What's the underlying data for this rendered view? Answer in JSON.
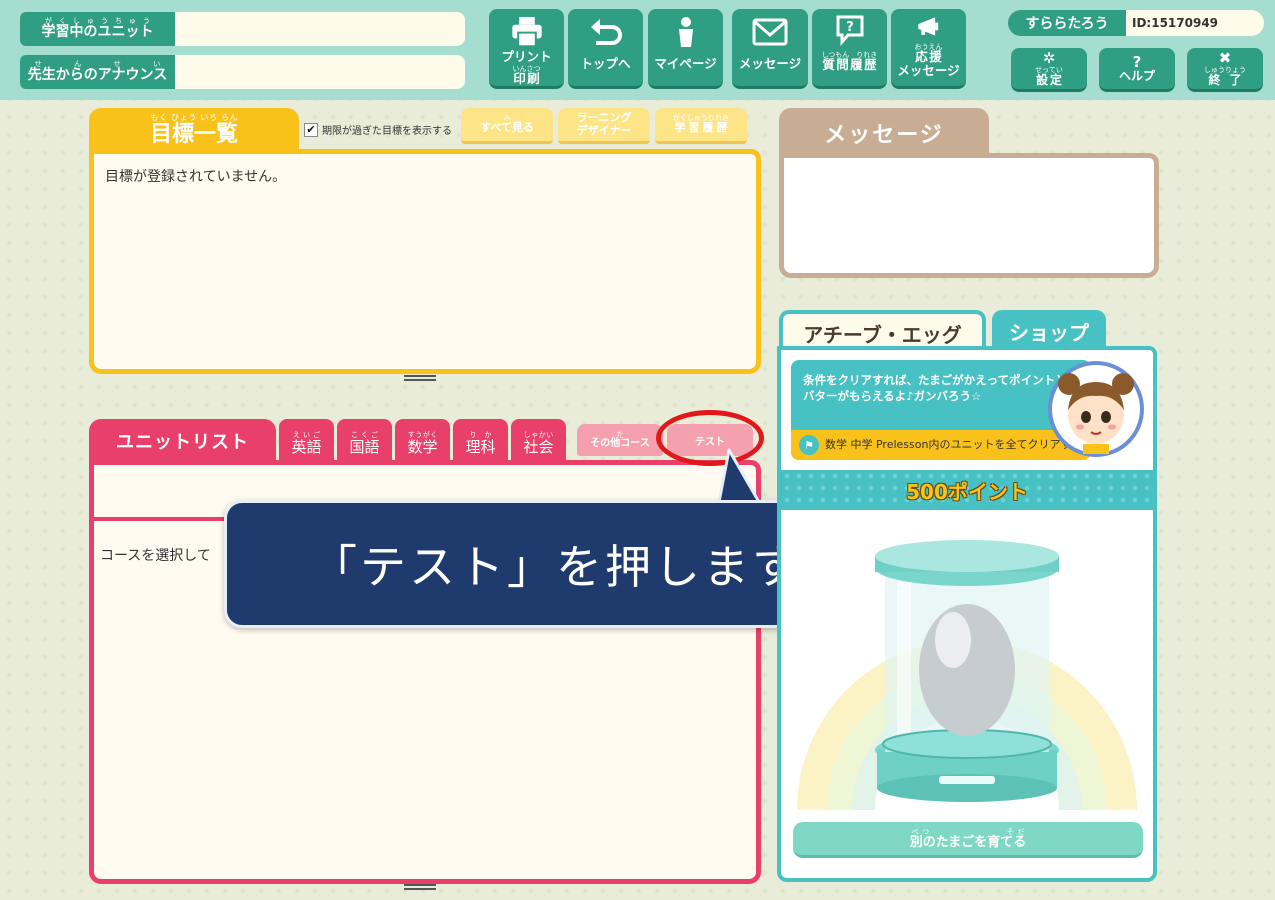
{
  "header": {
    "unit_label_ruby": "がくしゅうちゅう",
    "unit_label": "学習中のユニット",
    "announce_label_ruby": "せんせい",
    "announce_label": "先生からのアナウンス",
    "nav": [
      {
        "label": "プリント",
        "ruby": "いんさつ",
        "label2": "印刷",
        "icon": "printer-icon"
      },
      {
        "label": "トップへ",
        "icon": "return-arrow-icon"
      },
      {
        "label": "マイページ",
        "icon": "person-icon"
      },
      {
        "label": "メッセージ",
        "icon": "envelope-icon"
      },
      {
        "ruby": "しつもん　りれき",
        "label": "質問履歴",
        "icon": "question-bubble-icon"
      },
      {
        "ruby": "おうえん",
        "label": "応援",
        "label2": "メッセージ",
        "icon": "megaphone-icon"
      }
    ],
    "user": {
      "name": "すららたろう",
      "id": "ID:15170949"
    },
    "system": [
      {
        "ruby": "せってい",
        "label": "設定",
        "icon": "gear-icon",
        "glyph": "✲"
      },
      {
        "label": "ヘルプ",
        "icon": "help-icon",
        "glyph": "?"
      },
      {
        "ruby": "しゅうりょう",
        "label": "終了",
        "icon": "close-icon",
        "glyph": "✖"
      }
    ]
  },
  "goals": {
    "title": "目標一覧",
    "title_ruby": "もく ひょう いち らん",
    "show_expired": "期限が過ぎた目標を表示する",
    "show_expired_checked": "✔",
    "buttons": [
      {
        "label": "すべて見る",
        "ruby": "み"
      },
      {
        "label": "ラーニング",
        "label2": "デザイナー"
      },
      {
        "label": "学習履歴",
        "ruby": "がくしゅうりれき"
      }
    ],
    "empty": "目標が登録されていません。"
  },
  "units": {
    "title": "ユニットリスト",
    "subjects": [
      {
        "label": "英語",
        "ruby": "えいご"
      },
      {
        "label": "国語",
        "ruby": "こくご"
      },
      {
        "label": "数学",
        "ruby": "すうがく"
      },
      {
        "label": "理科",
        "ruby": "りか"
      },
      {
        "label": "社会",
        "ruby": "しゃかい"
      }
    ],
    "other_course": "その他コース",
    "other_course_ruby": "た",
    "test": "テスト",
    "placeholder": "コースを選択して"
  },
  "callout": {
    "text": "「テスト」を押します！",
    "color": "#1f3b6e"
  },
  "message": {
    "title": "メッセージ"
  },
  "egg": {
    "tab_achieve": "アチーブ・エッグ",
    "tab_shop": "ショップ",
    "info": "条件をクリアすれば、たまごがかえってポイントとアバターがもらえるよ♪ガンバろう☆",
    "condition": "数学 中学 Prelesson内のユニットを全てクリアする",
    "points": "500ポイント",
    "grow_button": "別のたまごを育てる",
    "grow_button_ruby": "べつ　　　　　　　そだ"
  }
}
